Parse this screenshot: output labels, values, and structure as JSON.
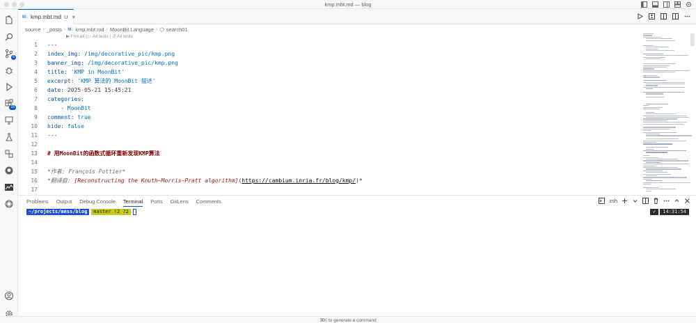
{
  "window": {
    "title": "kmp.mbt.md — blog"
  },
  "tab": {
    "icon": "M↓",
    "name": "kmp.mbt.md",
    "status": "U",
    "close": "×"
  },
  "breadcrumb": [
    "source",
    "_posts",
    "kmp.mbt.md",
    "MoonBit Language",
    "search01"
  ],
  "codelens": "▶ Fmt all | ▷ All tests | ↺ All tests",
  "editor": {
    "lines": [
      {
        "n": "1",
        "parts": [
          {
            "t": "---",
            "c": ""
          }
        ]
      },
      {
        "n": "2",
        "parts": [
          {
            "t": "index_img",
            "c": "k"
          },
          {
            "t": ": ",
            "c": ""
          },
          {
            "t": "/img/decorative_pic/kmp.png",
            "c": "v"
          }
        ]
      },
      {
        "n": "3",
        "parts": [
          {
            "t": "banner_img",
            "c": "k"
          },
          {
            "t": ": ",
            "c": ""
          },
          {
            "t": "/img/decorative_pic/kmp.png",
            "c": "v"
          }
        ]
      },
      {
        "n": "4",
        "parts": [
          {
            "t": "title",
            "c": "k"
          },
          {
            "t": ": ",
            "c": ""
          },
          {
            "t": "'KMP in MoonBit'",
            "c": "v"
          }
        ]
      },
      {
        "n": "5",
        "parts": [
          {
            "t": "excerpt",
            "c": "k"
          },
          {
            "t": ": ",
            "c": ""
          },
          {
            "t": "'KMP 算法的 MoonBit 描述'",
            "c": "v"
          }
        ]
      },
      {
        "n": "6",
        "parts": [
          {
            "t": "date",
            "c": "k"
          },
          {
            "t": ": 2025-05-21 15:45:21",
            "c": ""
          }
        ]
      },
      {
        "n": "7",
        "parts": [
          {
            "t": "categories",
            "c": "k"
          },
          {
            "t": ":",
            "c": ""
          }
        ]
      },
      {
        "n": "8",
        "parts": [
          {
            "t": "    - ",
            "c": ""
          },
          {
            "t": "MoonBit",
            "c": "v"
          }
        ]
      },
      {
        "n": "9",
        "parts": [
          {
            "t": "comment",
            "c": "k"
          },
          {
            "t": ": ",
            "c": ""
          },
          {
            "t": "true",
            "c": "v"
          }
        ]
      },
      {
        "n": "10",
        "parts": [
          {
            "t": "hide",
            "c": "k"
          },
          {
            "t": ": ",
            "c": ""
          },
          {
            "t": "false",
            "c": "v"
          }
        ]
      },
      {
        "n": "11",
        "parts": [
          {
            "t": "---",
            "c": ""
          }
        ]
      },
      {
        "n": "12",
        "parts": []
      },
      {
        "n": "13",
        "parts": [
          {
            "t": "# 用MoonBit的函数式循环重新发现KMP算法",
            "c": "h"
          }
        ]
      },
      {
        "n": "14",
        "parts": []
      },
      {
        "n": "15",
        "parts": [
          {
            "t": "*作者: François Pottier*",
            "c": "i"
          }
        ]
      },
      {
        "n": "16",
        "parts": [
          {
            "t": "*翻译自: ",
            "c": "i"
          },
          {
            "t": "[Reconstructing the Knuth–Morris–Pratt algorithm]",
            "c": "il"
          },
          {
            "t": "(",
            "c": ""
          },
          {
            "t": "https://cambium.inria.fr/blog/kmp/",
            "c": "u"
          },
          {
            "t": ")*",
            "c": ""
          }
        ]
      },
      {
        "n": "17",
        "parts": []
      }
    ]
  },
  "panel": {
    "tabs": [
      "Problems",
      "Output",
      "Debug Console",
      "Terminal",
      "Ports",
      "GitLens",
      "Comments"
    ],
    "active_tab": "Terminal",
    "shell": "zsh",
    "prompt": {
      "path": "~/projects/mess/blog",
      "git": "master !2 ?2",
      "status": "✓",
      "time": "14:31:54"
    }
  },
  "status": {
    "hint": "⌘K to generate a command"
  },
  "activity_badges": {
    "scm": "6",
    "extensions": "15"
  },
  "colors": {
    "accent": "#005fb8",
    "path_bg": "#1d4ed8",
    "git_bg": "#c7c91a"
  }
}
